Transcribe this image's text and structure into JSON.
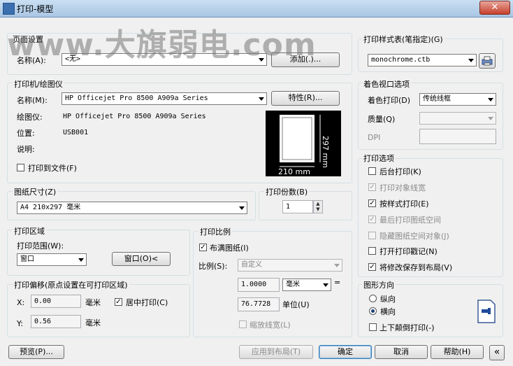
{
  "window": {
    "title": "打印-模型",
    "close_label": "✕"
  },
  "watermark": "www.大旗弱电.com",
  "page_setup": {
    "header": "页面设置",
    "name_label": "名称(A):",
    "name_value": "<无>",
    "add_button": "添加(.)..."
  },
  "printer": {
    "header": "打印机/绘图仪",
    "name_label": "名称(M):",
    "name_value": "HP Officejet Pro 8500 A909a Series",
    "props_button": "特性(R)...",
    "plotter_label": "绘图仪:",
    "plotter_value": "HP Officejet Pro 8500 A909a Series",
    "location_label": "位置:",
    "location_value": "USB001",
    "desc_label": "说明:",
    "print_to_file": "打印到文件(F)",
    "preview_width": "210 mm",
    "preview_height": "297 mm"
  },
  "paper": {
    "header": "图纸尺寸(Z)",
    "value": "A4 210x297 毫米"
  },
  "copies": {
    "header": "打印份数(B)",
    "value": "1"
  },
  "area": {
    "header": "打印区域",
    "range_label": "打印范围(W):",
    "range_value": "窗口",
    "window_button": "窗口(O)<"
  },
  "offset": {
    "header": "打印偏移(原点设置在可打印区域)",
    "x_label": "X:",
    "x_value": "0.00",
    "x_unit": "毫米",
    "y_label": "Y:",
    "y_value": "0.56",
    "y_unit": "毫米",
    "center": "居中打印(C)"
  },
  "scale": {
    "header": "打印比例",
    "fit": "布满图纸(I)",
    "ratio_label": "比例(S):",
    "ratio_value": "自定义",
    "value1": "1.0000",
    "unit1": "毫米",
    "value2": "76.7728",
    "unit2": "单位(U)",
    "lineweight": "缩放线宽(L)"
  },
  "style_table": {
    "header": "打印样式表(笔指定)(G)",
    "value": "monochrome.ctb"
  },
  "shaded": {
    "header": "着色视口选项",
    "shade_label": "着色打印(D)",
    "shade_value": "传统线框",
    "quality_label": "质量(Q)",
    "dpi_label": "DPI"
  },
  "options": {
    "header": "打印选项",
    "items": [
      {
        "label": "后台打印(K)",
        "checked": "",
        "disabled": false
      },
      {
        "label": "打印对象线宽",
        "checked": "✓",
        "disabled": true
      },
      {
        "label": "按样式打印(E)",
        "checked": "✓",
        "disabled": false
      },
      {
        "label": "最后打印图纸空间",
        "checked": "✓",
        "disabled": true
      },
      {
        "label": "隐藏图纸空间对象(J)",
        "checked": "",
        "disabled": true
      },
      {
        "label": "打开打印戳记(N)",
        "checked": "",
        "disabled": false
      },
      {
        "label": "将修改保存到布局(V)",
        "checked": "✓",
        "disabled": false
      }
    ]
  },
  "orientation": {
    "header": "图形方向",
    "portrait": "纵向",
    "landscape": "横向",
    "upside_down": "上下颠倒打印(-)"
  },
  "footer": {
    "preview": "预览(P)...",
    "apply": "应用到布局(T)",
    "ok": "确定",
    "cancel": "取消",
    "help": "帮助(H)",
    "collapse": "«"
  },
  "check_mark": "✓"
}
